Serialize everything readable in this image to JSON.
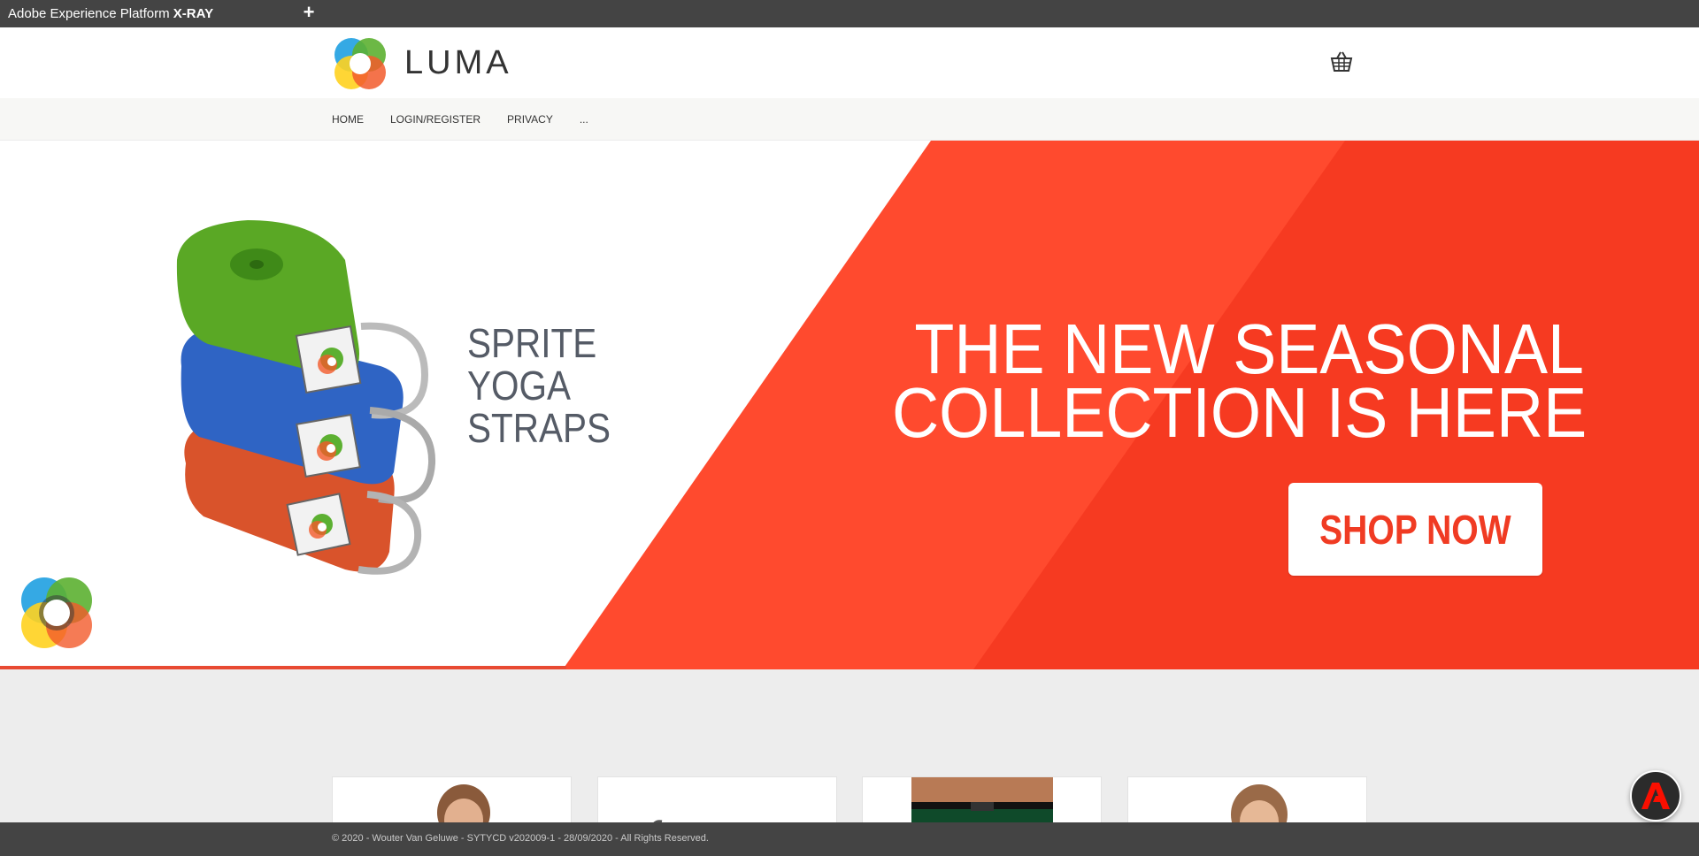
{
  "xray": {
    "title_prefix": "Adobe Experience Platform",
    "title_bold": "X-RAY",
    "add_label": "+"
  },
  "header": {
    "brand": "LUMA",
    "cart_icon": "basket-icon"
  },
  "nav": {
    "items": [
      "HOME",
      "LOGIN/REGISTER",
      "PRIVACY",
      "..."
    ]
  },
  "hero": {
    "tagline_lines": [
      "SPRITE",
      "YOGA",
      "STRAPS"
    ],
    "headline_lines": [
      "THE NEW SEASONAL",
      "COLLECTION IS HERE"
    ],
    "cta_label": "SHOP NOW",
    "colors": {
      "accent": "#f03b23",
      "accent_light": "#ff5a3c",
      "strap_green": "#5aa825",
      "strap_blue": "#2f64c4",
      "strap_orange": "#d9532b"
    }
  },
  "products": {
    "count": 4
  },
  "footer": {
    "copyright": "© 2020 - Wouter Van Geluwe - SYTYCD v202009-1 - 28/09/2020 - All Rights Reserved."
  },
  "fab": {
    "icon": "adobe-icon"
  }
}
